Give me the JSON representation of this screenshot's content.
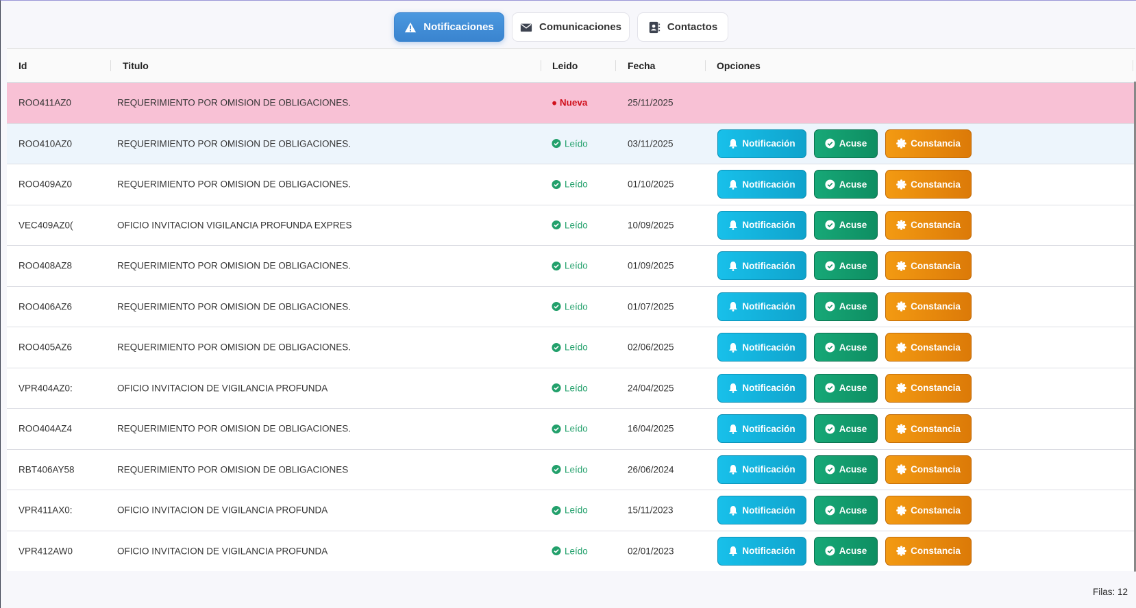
{
  "tabs": [
    {
      "label": "Notificaciones",
      "icon": "warning-icon",
      "active": true
    },
    {
      "label": "Comunicaciones",
      "icon": "envelope-icon"
    },
    {
      "label": "Contactos",
      "icon": "contact-book-icon"
    }
  ],
  "columns": {
    "id": "Id",
    "titulo": "Titulo",
    "leido": "Leido",
    "fecha": "Fecha",
    "opciones": "Opciones"
  },
  "buttons": {
    "notificacion": "Notificación",
    "acuse": "Acuse",
    "constancia": "Constancia"
  },
  "colors": {
    "new_row": "#f8c1d5",
    "nueva": "#d0101c",
    "leido": "#22a06b",
    "notificacion": "#18c0ea",
    "acuse": "#17a877",
    "constancia": "#f39a12",
    "active_tab": "#4a98df"
  },
  "rows": [
    {
      "id": "ROO411AZ0",
      "titulo": "REQUERIMIENTO POR OMISION DE OBLIGACIONES.",
      "estado": "Nueva",
      "fecha": "25/11/2025"
    },
    {
      "id": "ROO410AZ0",
      "titulo": "REQUERIMIENTO POR OMISION DE OBLIGACIONES.",
      "estado": "Leído",
      "fecha": "03/11/2025"
    },
    {
      "id": "ROO409AZ0",
      "titulo": "REQUERIMIENTO POR OMISION DE OBLIGACIONES.",
      "estado": "Leído",
      "fecha": "01/10/2025"
    },
    {
      "id": "VEC409AZ0(",
      "titulo": "OFICIO INVITACION VIGILANCIA PROFUNDA EXPRES",
      "estado": "Leído",
      "fecha": "10/09/2025"
    },
    {
      "id": "ROO408AZ8",
      "titulo": "REQUERIMIENTO POR OMISION DE OBLIGACIONES.",
      "estado": "Leído",
      "fecha": "01/09/2025"
    },
    {
      "id": "ROO406AZ6",
      "titulo": "REQUERIMIENTO POR OMISION DE OBLIGACIONES.",
      "estado": "Leído",
      "fecha": "01/07/2025"
    },
    {
      "id": "ROO405AZ6",
      "titulo": "REQUERIMIENTO POR OMISION DE OBLIGACIONES.",
      "estado": "Leído",
      "fecha": "02/06/2025"
    },
    {
      "id": "VPR404AZ0:",
      "titulo": "OFICIO INVITACION DE VIGILANCIA PROFUNDA",
      "estado": "Leído",
      "fecha": "24/04/2025"
    },
    {
      "id": "ROO404AZ4",
      "titulo": "REQUERIMIENTO POR OMISION DE OBLIGACIONES.",
      "estado": "Leído",
      "fecha": "16/04/2025"
    },
    {
      "id": "RBT406AY58",
      "titulo": "REQUERIMIENTO POR OMISION DE OBLIGACIONES",
      "estado": "Leído",
      "fecha": "26/06/2024"
    },
    {
      "id": "VPR411AX0:",
      "titulo": "OFICIO INVITACION DE VIGILANCIA PROFUNDA",
      "estado": "Leído",
      "fecha": "15/11/2023"
    },
    {
      "id": "VPR412AW0",
      "titulo": "OFICIO INVITACION DE VIGILANCIA PROFUNDA",
      "estado": "Leído",
      "fecha": "02/01/2023"
    }
  ],
  "footer": {
    "rows_count": "Filas: 12"
  }
}
